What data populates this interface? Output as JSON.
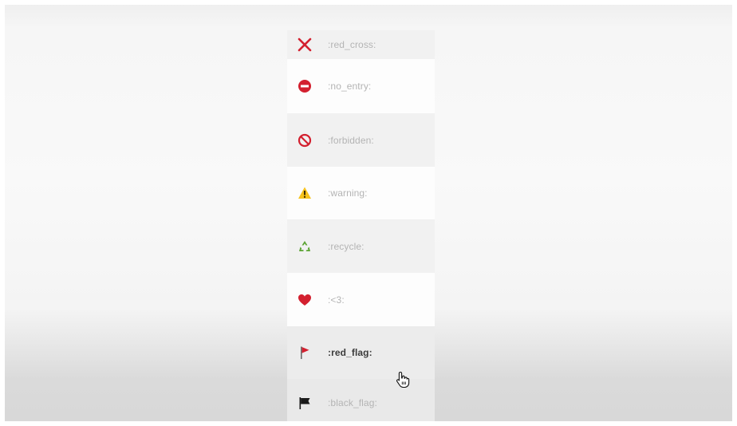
{
  "emoji_list": {
    "items": [
      {
        "icon": "cross-mark-icon",
        "label": ":red_cross:"
      },
      {
        "icon": "no-entry-icon",
        "label": ":no_entry:"
      },
      {
        "icon": "prohibited-icon",
        "label": ":forbidden:"
      },
      {
        "icon": "warning-sign-icon",
        "label": ":warning:"
      },
      {
        "icon": "recycle-icon",
        "label": ":recycle:"
      },
      {
        "icon": "red-heart-icon",
        "label": ":<3:"
      },
      {
        "icon": "red-flag-icon",
        "label": ":red_flag:",
        "state": "hovered"
      },
      {
        "icon": "black-flag-icon",
        "label": ":black_flag:"
      }
    ]
  },
  "cursor": {
    "icon": "hand-pointer-cursor-icon"
  },
  "colors": {
    "red": "#d3202f",
    "warning_yellow": "#f6c21c",
    "recycle_green": "#5aa332",
    "label_gray": "#b4b4b4",
    "label_hover": "#3c3c3c"
  }
}
